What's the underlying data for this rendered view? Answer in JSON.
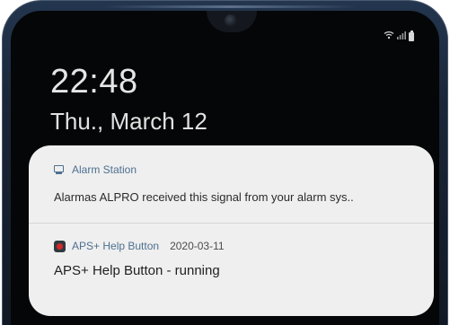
{
  "lock_screen": {
    "time": "22:48",
    "date": "Thu., March 12"
  },
  "status_bar": {
    "icons": [
      "wifi-icon",
      "signal-icon",
      "battery-icon"
    ]
  },
  "notifications": [
    {
      "icon": "monitor-icon",
      "app_name": "Alarm Station",
      "text": "Alarmas ALPRO received this signal from your alarm sys.."
    },
    {
      "icon": "help-button-icon",
      "app_name": "APS+ Help Button",
      "timestamp": "2020-03-11",
      "text": "APS+ Help Button - running"
    }
  ],
  "colors": {
    "app_name": "#4d7090",
    "panel_bg": "#efefef",
    "screen_bg": "#050607",
    "phone_frame": "#1a2638"
  }
}
